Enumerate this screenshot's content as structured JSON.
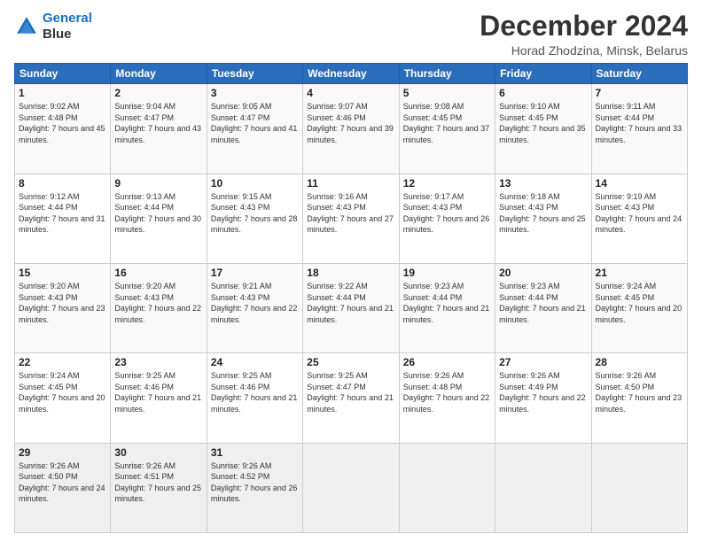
{
  "logo": {
    "line1": "General",
    "line2": "Blue"
  },
  "title": "December 2024",
  "subtitle": "Horad Zhodzina, Minsk, Belarus",
  "days_of_week": [
    "Sunday",
    "Monday",
    "Tuesday",
    "Wednesday",
    "Thursday",
    "Friday",
    "Saturday"
  ],
  "weeks": [
    [
      {
        "day": "1",
        "sunrise": "9:02 AM",
        "sunset": "4:48 PM",
        "daylight": "7 hours and 45 minutes."
      },
      {
        "day": "2",
        "sunrise": "9:04 AM",
        "sunset": "4:47 PM",
        "daylight": "7 hours and 43 minutes."
      },
      {
        "day": "3",
        "sunrise": "9:05 AM",
        "sunset": "4:47 PM",
        "daylight": "7 hours and 41 minutes."
      },
      {
        "day": "4",
        "sunrise": "9:07 AM",
        "sunset": "4:46 PM",
        "daylight": "7 hours and 39 minutes."
      },
      {
        "day": "5",
        "sunrise": "9:08 AM",
        "sunset": "4:45 PM",
        "daylight": "7 hours and 37 minutes."
      },
      {
        "day": "6",
        "sunrise": "9:10 AM",
        "sunset": "4:45 PM",
        "daylight": "7 hours and 35 minutes."
      },
      {
        "day": "7",
        "sunrise": "9:11 AM",
        "sunset": "4:44 PM",
        "daylight": "7 hours and 33 minutes."
      }
    ],
    [
      {
        "day": "8",
        "sunrise": "9:12 AM",
        "sunset": "4:44 PM",
        "daylight": "7 hours and 31 minutes."
      },
      {
        "day": "9",
        "sunrise": "9:13 AM",
        "sunset": "4:44 PM",
        "daylight": "7 hours and 30 minutes."
      },
      {
        "day": "10",
        "sunrise": "9:15 AM",
        "sunset": "4:43 PM",
        "daylight": "7 hours and 28 minutes."
      },
      {
        "day": "11",
        "sunrise": "9:16 AM",
        "sunset": "4:43 PM",
        "daylight": "7 hours and 27 minutes."
      },
      {
        "day": "12",
        "sunrise": "9:17 AM",
        "sunset": "4:43 PM",
        "daylight": "7 hours and 26 minutes."
      },
      {
        "day": "13",
        "sunrise": "9:18 AM",
        "sunset": "4:43 PM",
        "daylight": "7 hours and 25 minutes."
      },
      {
        "day": "14",
        "sunrise": "9:19 AM",
        "sunset": "4:43 PM",
        "daylight": "7 hours and 24 minutes."
      }
    ],
    [
      {
        "day": "15",
        "sunrise": "9:20 AM",
        "sunset": "4:43 PM",
        "daylight": "7 hours and 23 minutes."
      },
      {
        "day": "16",
        "sunrise": "9:20 AM",
        "sunset": "4:43 PM",
        "daylight": "7 hours and 22 minutes."
      },
      {
        "day": "17",
        "sunrise": "9:21 AM",
        "sunset": "4:43 PM",
        "daylight": "7 hours and 22 minutes."
      },
      {
        "day": "18",
        "sunrise": "9:22 AM",
        "sunset": "4:44 PM",
        "daylight": "7 hours and 21 minutes."
      },
      {
        "day": "19",
        "sunrise": "9:23 AM",
        "sunset": "4:44 PM",
        "daylight": "7 hours and 21 minutes."
      },
      {
        "day": "20",
        "sunrise": "9:23 AM",
        "sunset": "4:44 PM",
        "daylight": "7 hours and 21 minutes."
      },
      {
        "day": "21",
        "sunrise": "9:24 AM",
        "sunset": "4:45 PM",
        "daylight": "7 hours and 20 minutes."
      }
    ],
    [
      {
        "day": "22",
        "sunrise": "9:24 AM",
        "sunset": "4:45 PM",
        "daylight": "7 hours and 20 minutes."
      },
      {
        "day": "23",
        "sunrise": "9:25 AM",
        "sunset": "4:46 PM",
        "daylight": "7 hours and 21 minutes."
      },
      {
        "day": "24",
        "sunrise": "9:25 AM",
        "sunset": "4:46 PM",
        "daylight": "7 hours and 21 minutes."
      },
      {
        "day": "25",
        "sunrise": "9:25 AM",
        "sunset": "4:47 PM",
        "daylight": "7 hours and 21 minutes."
      },
      {
        "day": "26",
        "sunrise": "9:26 AM",
        "sunset": "4:48 PM",
        "daylight": "7 hours and 22 minutes."
      },
      {
        "day": "27",
        "sunrise": "9:26 AM",
        "sunset": "4:49 PM",
        "daylight": "7 hours and 22 minutes."
      },
      {
        "day": "28",
        "sunrise": "9:26 AM",
        "sunset": "4:50 PM",
        "daylight": "7 hours and 23 minutes."
      }
    ],
    [
      {
        "day": "29",
        "sunrise": "9:26 AM",
        "sunset": "4:50 PM",
        "daylight": "7 hours and 24 minutes."
      },
      {
        "day": "30",
        "sunrise": "9:26 AM",
        "sunset": "4:51 PM",
        "daylight": "7 hours and 25 minutes."
      },
      {
        "day": "31",
        "sunrise": "9:26 AM",
        "sunset": "4:52 PM",
        "daylight": "7 hours and 26 minutes."
      },
      null,
      null,
      null,
      null
    ]
  ]
}
